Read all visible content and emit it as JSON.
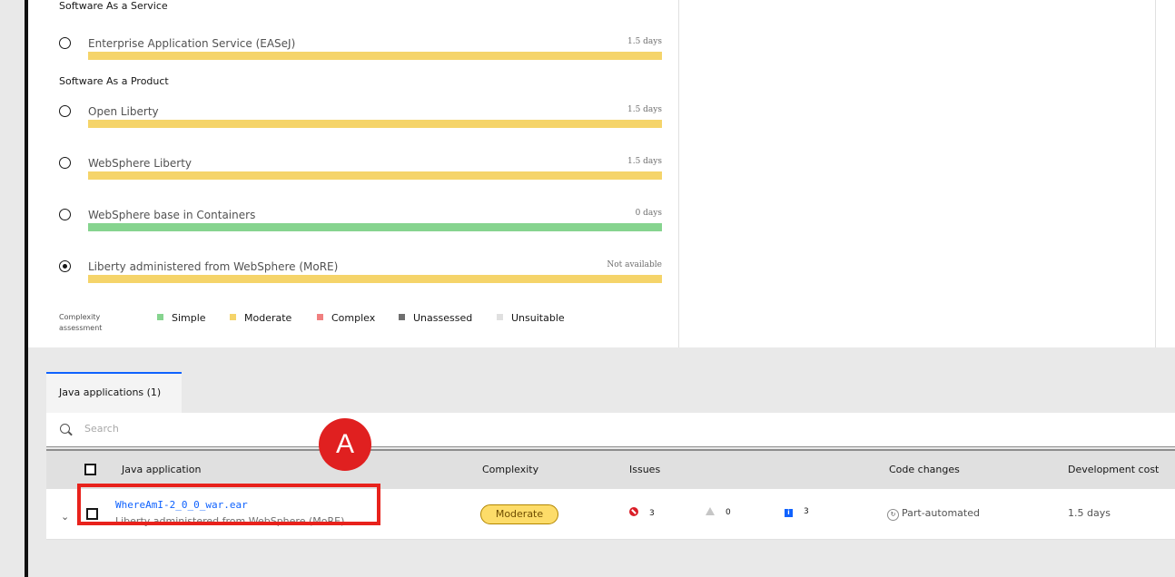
{
  "colors": {
    "simple": "#86d48f",
    "moderate": "#f5d46a",
    "complex": "#f08080",
    "unassessed": "#6f6f6f",
    "unsuitable": "#e0e0e0",
    "accent": "#0f62fe",
    "annotation": "#e8221c"
  },
  "targets": {
    "saas_heading": "Software As a Service",
    "saas_options": [
      {
        "label": "Enterprise Application Service (EASeJ)",
        "value": "1.5 days",
        "complexity": "moderate",
        "selected": false
      }
    ],
    "sap_heading": "Software As a Product",
    "sap_options": [
      {
        "label": "Open Liberty",
        "value": "1.5 days",
        "complexity": "moderate",
        "selected": false
      },
      {
        "label": "WebSphere Liberty",
        "value": "1.5 days",
        "complexity": "moderate",
        "selected": false
      },
      {
        "label": "WebSphere base in Containers",
        "value": "0 days",
        "complexity": "simple",
        "selected": false
      },
      {
        "label": "Liberty administered from WebSphere (MoRE)",
        "value": "Not available",
        "complexity": "moderate",
        "selected": true
      }
    ]
  },
  "legend": {
    "title": "Complexity assessment",
    "items": [
      "Simple",
      "Moderate",
      "Complex",
      "Unassessed",
      "Unsuitable"
    ]
  },
  "tabs": [
    {
      "label": "Java applications (1)",
      "active": true
    }
  ],
  "search": {
    "placeholder": "Search",
    "value": ""
  },
  "table": {
    "headers": [
      "Java application",
      "Complexity",
      "Issues",
      "Code changes",
      "Development cost"
    ],
    "rows": [
      {
        "app_name": "WhereAmI-2_0_0_war.ear",
        "target": "Liberty administered from WebSphere (MoRE)",
        "complexity": "Moderate",
        "issues": {
          "critical": "3",
          "warning": "0",
          "info": "3"
        },
        "code_changes": "Part-automated",
        "dev_cost": "1.5 days"
      }
    ]
  },
  "annotation": {
    "label": "A"
  },
  "icons": [
    "search-icon",
    "chevron-down-icon",
    "error-icon",
    "warning-icon",
    "info-icon",
    "automation-icon"
  ]
}
